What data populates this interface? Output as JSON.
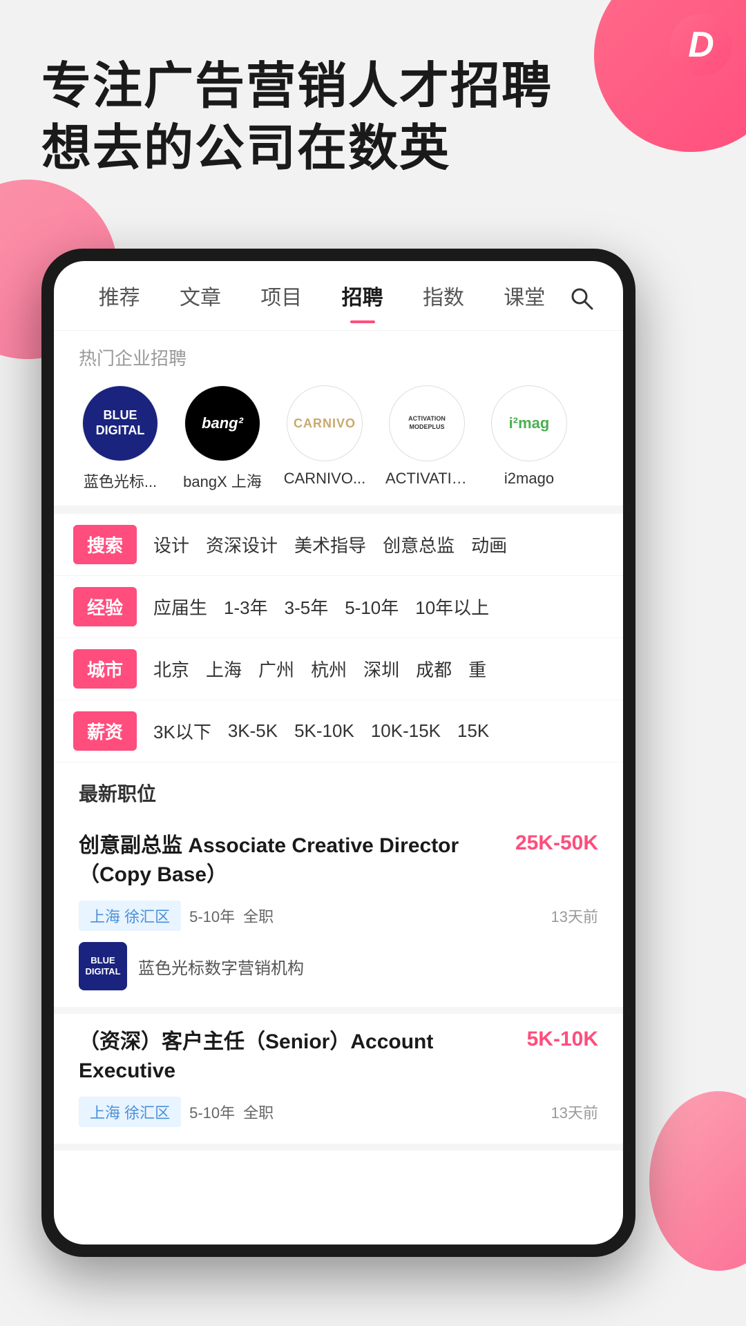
{
  "app": {
    "logo": "D",
    "hero_line1": "专注广告营销人才招聘",
    "hero_line2": "想去的公司在数英"
  },
  "nav": {
    "items": [
      {
        "label": "推荐",
        "active": false
      },
      {
        "label": "文章",
        "active": false
      },
      {
        "label": "项目",
        "active": false
      },
      {
        "label": "招聘",
        "active": true
      },
      {
        "label": "指数",
        "active": false
      },
      {
        "label": "课堂",
        "active": false
      }
    ],
    "search_icon": "🔍"
  },
  "hot_companies": {
    "label": "热门企业招聘",
    "items": [
      {
        "id": "blue-digital",
        "name": "蓝色光标...",
        "logo_text": "BLUE\nDIGITAL",
        "type": "blue-digital"
      },
      {
        "id": "bangx",
        "name": "bangX 上海",
        "logo_text": "bang²",
        "type": "bangx"
      },
      {
        "id": "carnivo",
        "name": "CARNIVO...",
        "logo_text": "CARNIVO",
        "type": "carnivo"
      },
      {
        "id": "activation",
        "name": "ACTIVATIO...",
        "logo_text": "ACTIVATION\nMODEPLUS",
        "type": "activation"
      },
      {
        "id": "i2mago",
        "name": "i2mago",
        "logo_text": "i²mag",
        "type": "i2mago"
      }
    ]
  },
  "filters": [
    {
      "badge": "搜索",
      "options": [
        "设计",
        "资深设计",
        "美术指导",
        "创意总监",
        "动画"
      ]
    },
    {
      "badge": "经验",
      "options": [
        "应届生",
        "1-3年",
        "3-5年",
        "5-10年",
        "10年以上"
      ]
    },
    {
      "badge": "城市",
      "options": [
        "北京",
        "上海",
        "广州",
        "杭州",
        "深圳",
        "成都",
        "重"
      ]
    },
    {
      "badge": "薪资",
      "options": [
        "3K以下",
        "3K-5K",
        "5K-10K",
        "10K-15K",
        "15K"
      ]
    }
  ],
  "jobs": {
    "label": "最新职位",
    "items": [
      {
        "title": "创意副总监 Associate Creative Director（Copy Base）",
        "salary": "25K-50K",
        "location": "上海 徐汇区",
        "experience": "5-10年",
        "type": "全职",
        "date": "13天前",
        "company_logo_type": "blue-digital",
        "company_logo_text": "BLUE\nDIGITAL",
        "company_name": "蓝色光标数字营销机构"
      },
      {
        "title": "（资深）客户主任（Senior）Account Executive",
        "salary": "5K-10K",
        "location": "上海 徐汇区",
        "experience": "5-10年",
        "type": "全职",
        "date": "13天前",
        "company_logo_type": null,
        "company_logo_text": null,
        "company_name": null
      }
    ]
  }
}
